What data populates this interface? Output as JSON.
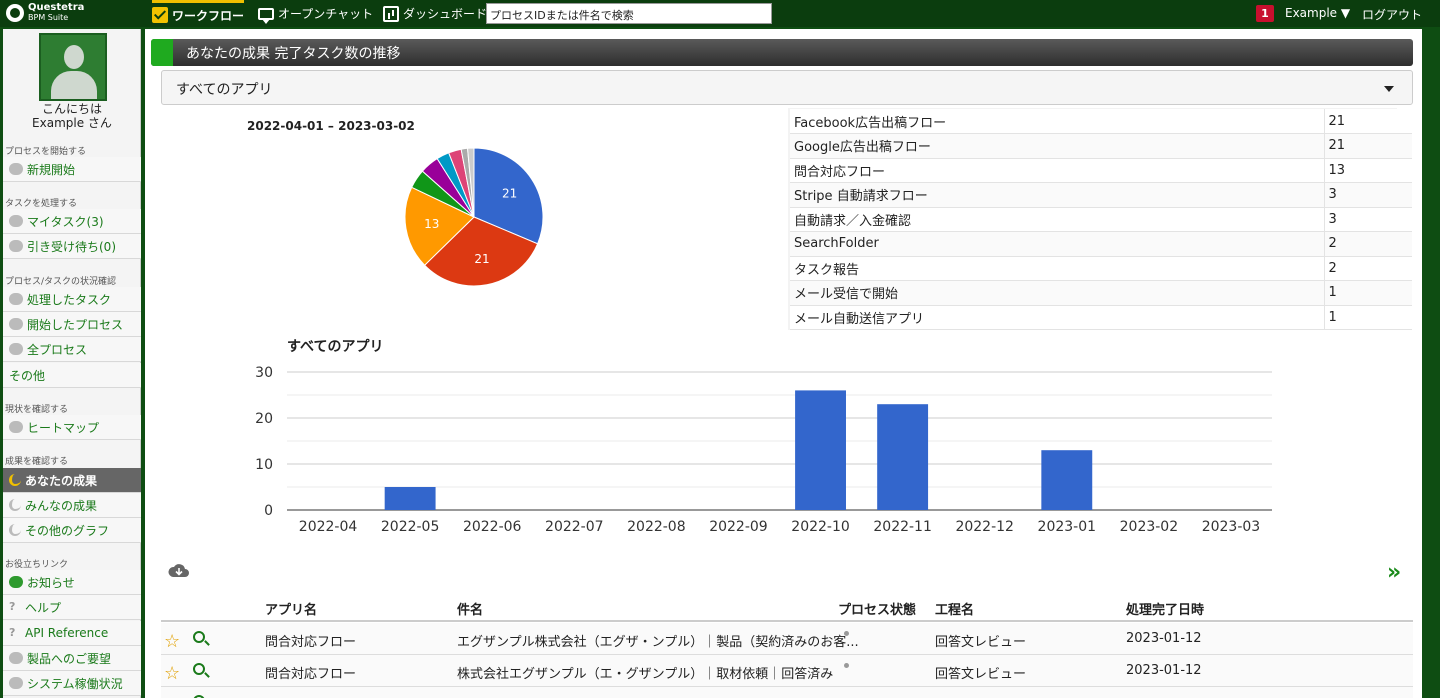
{
  "topbar": {
    "logo_name": "Questetra",
    "logo_sub": "BPM Suite",
    "nav": [
      "ワークフロー",
      "オープンチャット",
      "ダッシュボード"
    ],
    "search_placeholder": "プロセスIDまたは件名で検索",
    "notification_count": "1",
    "user": "Example ▼",
    "logout": "ログアウト"
  },
  "sidebar": {
    "greeting_line1": "こんにちは",
    "greeting_line2": "Example さん",
    "sections": {
      "start": "プロセスを開始する",
      "process": "タスクを処理する",
      "status": "プロセス/タスクの状況確認",
      "current": "現状を確認する",
      "results": "成果を確認する",
      "links": "お役立ちリンク"
    },
    "items": {
      "new_start": "新規開始",
      "my_tasks": "マイタスク(3)",
      "offered": "引き受け待ち(0)",
      "handled": "処理したタスク",
      "started": "開始したプロセス",
      "all_process": "全プロセス",
      "other": "その他",
      "heatmap": "ヒートマップ",
      "your_results": "あなたの成果",
      "everyone_results": "みんなの成果",
      "other_graphs": "その他のグラフ",
      "news": "お知らせ",
      "help": "ヘルプ",
      "api": "API Reference",
      "request": "製品へのご要望",
      "system_status": "システム稼働状況"
    }
  },
  "main": {
    "title": "あなたの成果 完了タスク数の推移",
    "app_select": "すべてのアプリ",
    "pie_range": "2022-04-01 – 2023-03-02",
    "app_table": [
      {
        "name": "Facebook広告出稿フロー",
        "count": "21"
      },
      {
        "name": "Google広告出稿フロー",
        "count": "21"
      },
      {
        "name": "問合対応フロー",
        "count": "13"
      },
      {
        "name": "Stripe 自動請求フロー",
        "count": "3"
      },
      {
        "name": "自動請求／入金確認",
        "count": "3"
      },
      {
        "name": "SearchFolder",
        "count": "2"
      },
      {
        "name": "タスク報告",
        "count": "2"
      },
      {
        "name": "メール受信で開始",
        "count": "1"
      },
      {
        "name": "メール自動送信アプリ",
        "count": "1"
      }
    ],
    "list_headers": {
      "app": "アプリ名",
      "subject": "件名",
      "state": "プロセス状態",
      "step": "工程名",
      "done": "処理完了日時"
    },
    "rows": [
      {
        "app": "問合対応フロー",
        "subject": "エグザンプル株式会社（エグザ・ンプル）｜製品（契約済みのお客...",
        "step": "回答文レビュー",
        "date": "2023-01-12"
      },
      {
        "app": "問合対応フロー",
        "subject": "株式会社エグザンプル（エ・グザンプル）｜取材依頼｜回答済み",
        "step": "回答文レビュー",
        "date": "2023-01-12"
      }
    ],
    "next_icon": "»"
  },
  "chart_data": [
    {
      "type": "pie",
      "title": "2022-04-01 – 2023-03-02",
      "labels": [
        "Facebook広告出稿フロー",
        "Google広告出稿フロー",
        "問合対応フロー",
        "Stripe 自動請求フロー",
        "自動請求／入金確認",
        "SearchFolder",
        "タスク報告",
        "メール受信で開始",
        "メール自動送信アプリ"
      ],
      "values": [
        21,
        21,
        13,
        3,
        3,
        2,
        2,
        1,
        1
      ],
      "data_labels": [
        "21",
        "21",
        "13"
      ],
      "colors": [
        "#3366cc",
        "#dc3912",
        "#ff9900",
        "#109618",
        "#990099",
        "#0099c6",
        "#dd4477",
        "#aaaaaa",
        "#cccccc"
      ]
    },
    {
      "type": "bar",
      "title": "すべてのアプリ",
      "categories": [
        "2022-04",
        "2022-05",
        "2022-06",
        "2022-07",
        "2022-08",
        "2022-09",
        "2022-10",
        "2022-11",
        "2022-12",
        "2023-01",
        "2023-02",
        "2023-03"
      ],
      "values": [
        0,
        5,
        0,
        0,
        0,
        0,
        26,
        23,
        0,
        13,
        0,
        0
      ],
      "ylim": [
        0,
        30
      ],
      "yticks": [
        0,
        10,
        20,
        30
      ],
      "grid": true,
      "color": "#3366cc"
    }
  ]
}
